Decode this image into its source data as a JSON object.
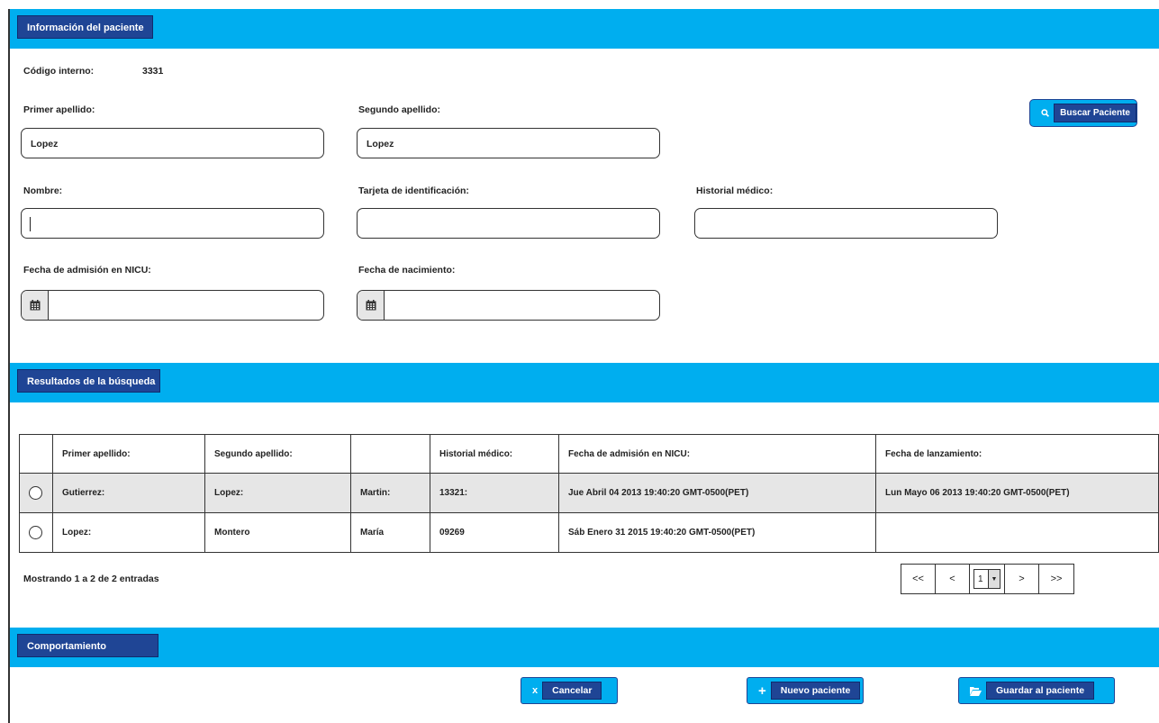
{
  "sections": {
    "info_title": "Información del paciente",
    "results_title": "Resultados de la búsqueda",
    "behavior_title": "Comportamiento"
  },
  "patient": {
    "code_label": "Código interno:",
    "code_value": "3331",
    "first_surname_label": "Primer apellido:",
    "first_surname_value": "Lopez",
    "second_surname_label": "Segundo apellido:",
    "second_surname_value": "Lopez",
    "name_label": "Nombre:",
    "name_value": "",
    "id_card_label": "Tarjeta de identificación:",
    "id_card_value": "",
    "medical_history_label": "Historial médico:",
    "medical_history_value": "",
    "nicu_admission_label": "Fecha de admisión en NICU:",
    "nicu_admission_value": "",
    "birth_date_label": "Fecha de nacimiento:",
    "birth_date_value": ""
  },
  "search_button": {
    "label": "Buscar Paciente",
    "icon": "search-icon"
  },
  "results": {
    "columns": [
      "",
      "Primer apellido:",
      "Segundo apellido:",
      "",
      "Historial médico:",
      "Fecha de admisión en NICU:",
      "Fecha de lanzamiento:"
    ],
    "rows": [
      {
        "selected": true,
        "cells": [
          "Gutierrez:",
          "Lopez:",
          "Martin:",
          "13321:",
          "Jue Abril 04 2013 19:40:20 GMT-0500(PET)",
          "Lun Mayo  06 2013 19:40:20 GMT-0500(PET)"
        ]
      },
      {
        "selected": false,
        "cells": [
          "Lopez:",
          "Montero",
          "María",
          "09269",
          "Sáb Enero 31 2015 19:40:20 GMT-0500(PET)",
          ""
        ]
      }
    ],
    "summary": "Mostrando 1 a 2 de 2 entradas"
  },
  "pagination": {
    "first": "<<",
    "prev": "<",
    "current_page": "1",
    "next": ">",
    "last": ">>"
  },
  "actions": {
    "cancel_label": "Cancelar",
    "cancel_icon": "x",
    "new_label": "Nuevo paciente",
    "new_icon": "+",
    "save_label": "Guardar al paciente"
  },
  "colors": {
    "band": "#00aeef",
    "label_bg": "#1f4595",
    "selected_row": "#e6e6e6"
  }
}
